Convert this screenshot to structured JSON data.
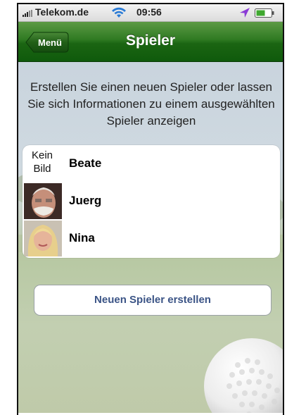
{
  "status_bar": {
    "carrier": "Telekom.de",
    "time": "09:56"
  },
  "nav": {
    "back_label": "Menü",
    "title": "Spieler"
  },
  "instruction": "Erstellen Sie einen neuen Spieler oder lassen Sie sich Informationen zu einem ausgewählten Spieler anzeigen",
  "players": [
    {
      "name": "Beate",
      "no_image_label": "Kein Bild",
      "avatar": "no-image"
    },
    {
      "name": "Juerg",
      "avatar": "photo-man"
    },
    {
      "name": "Nina",
      "avatar": "photo-woman"
    }
  ],
  "create_button": "Neuen Spieler erstellen",
  "colors": {
    "nav_green": "#1b6512",
    "button_text": "#3b5486"
  }
}
